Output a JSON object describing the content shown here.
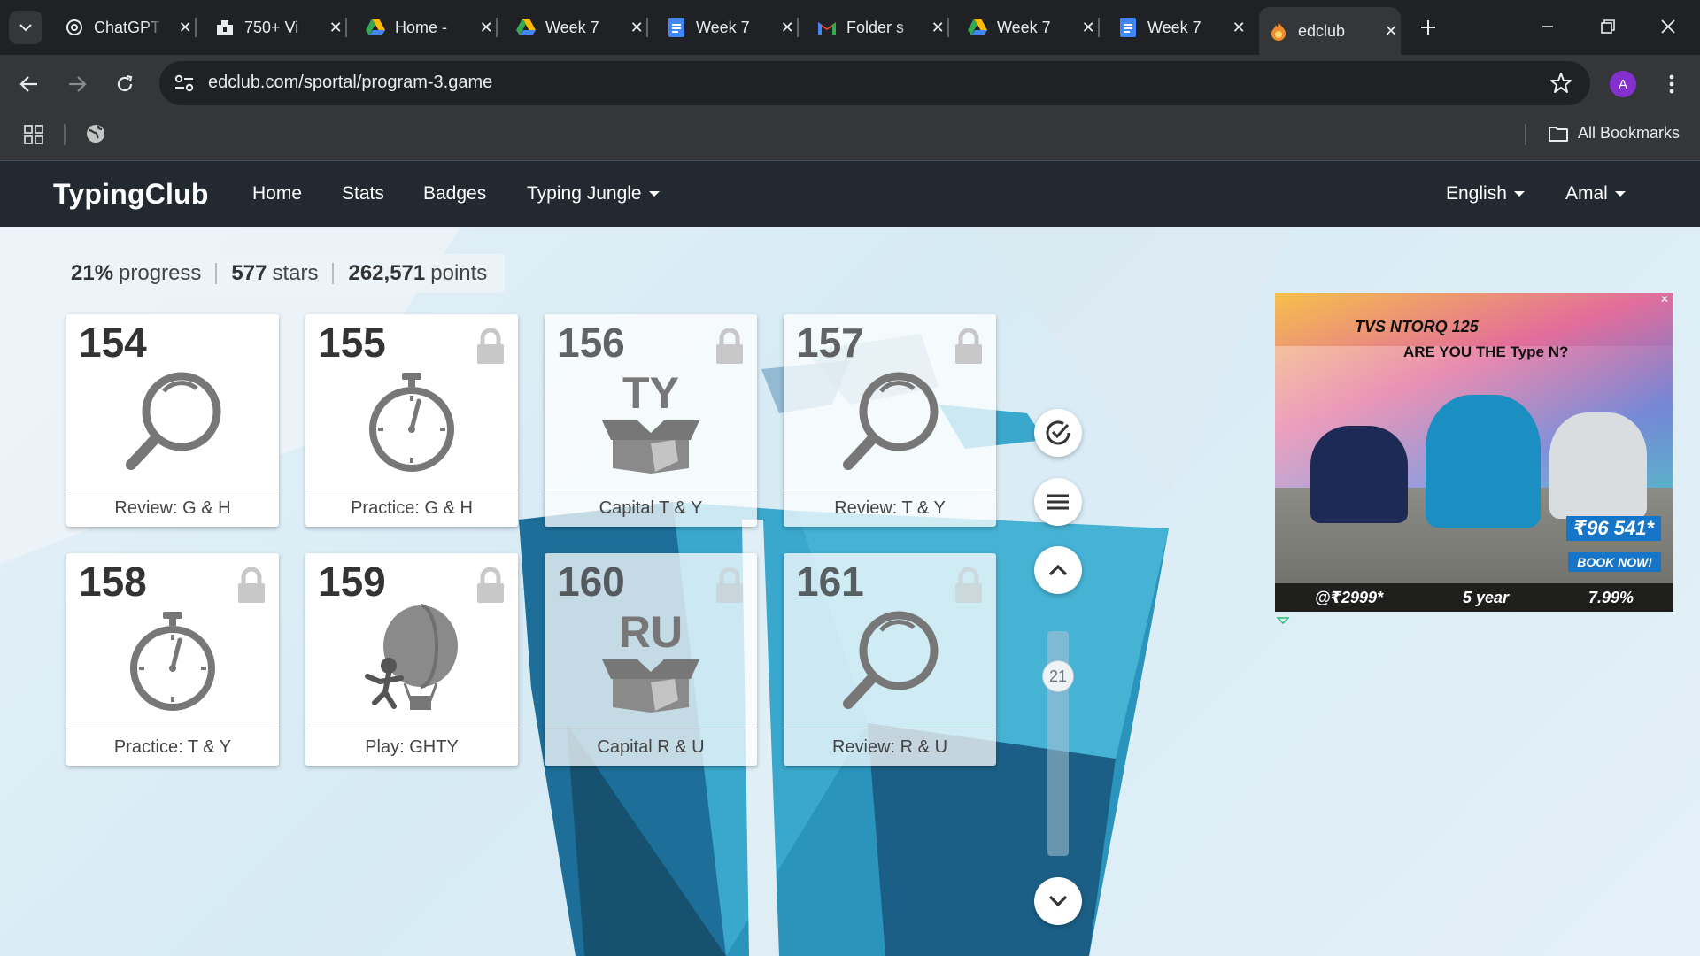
{
  "browser": {
    "tabs": [
      {
        "title": "ChatGPT",
        "icon": "chatgpt-icon"
      },
      {
        "title": "750+ Vi",
        "icon": "site-icon"
      },
      {
        "title": "Home -",
        "icon": "drive-icon"
      },
      {
        "title": "Week 7",
        "icon": "drive-icon"
      },
      {
        "title": "Week 7",
        "icon": "docs-icon"
      },
      {
        "title": "Folder s",
        "icon": "gmail-icon"
      },
      {
        "title": "Week 7",
        "icon": "drive-icon"
      },
      {
        "title": "Week 7",
        "icon": "docs-icon"
      },
      {
        "title": "edclub",
        "icon": "edclub-icon",
        "active": true
      }
    ],
    "url": "edclub.com/sportal/program-3.game",
    "profile_initial": "A",
    "bookmarks_label": "All Bookmarks"
  },
  "site": {
    "brand": "TypingClub",
    "nav": [
      "Home",
      "Stats",
      "Badges",
      "Typing Jungle"
    ],
    "language": "English",
    "user": "Amal"
  },
  "stats": {
    "progress_value": "21%",
    "progress_label": "progress",
    "stars_value": "577",
    "stars_label": "stars",
    "points_value": "262,571",
    "points_label": "points"
  },
  "lessons": [
    {
      "number": "154",
      "label": "Review: G & H",
      "icon": "magnifier-icon",
      "locked": false
    },
    {
      "number": "155",
      "label": "Practice: G & H",
      "icon": "stopwatch-icon",
      "locked": true
    },
    {
      "number": "156",
      "label": "Capital T & Y",
      "icon": "box-icon",
      "box_text": "TY",
      "locked": true
    },
    {
      "number": "157",
      "label": "Review: T & Y",
      "icon": "magnifier-icon",
      "locked": true
    },
    {
      "number": "158",
      "label": "Practice: T & Y",
      "icon": "stopwatch-icon",
      "locked": true
    },
    {
      "number": "159",
      "label": "Play: GHTY",
      "icon": "balloon-ninja-icon",
      "locked": true
    },
    {
      "number": "160",
      "label": "Capital R & U",
      "icon": "box-icon",
      "box_text": "RU",
      "locked": true
    },
    {
      "number": "161",
      "label": "Review: R & U",
      "icon": "magnifier-icon",
      "locked": true
    }
  ],
  "pager": {
    "current": "21"
  },
  "ad": {
    "brand": "TVS NTORQ 125",
    "tagline": "ARE YOU THE Type N?",
    "price": "₹96 541*",
    "cta": "BOOK NOW!",
    "emi": "@₹2999*",
    "loan": "5 year",
    "rate": "7.99%"
  },
  "colors": {
    "navbar": "#222931",
    "browser_dark": "#202124",
    "browser_toolbar": "#35363a",
    "card_icon": "#777777",
    "profile": "#8430ce"
  }
}
